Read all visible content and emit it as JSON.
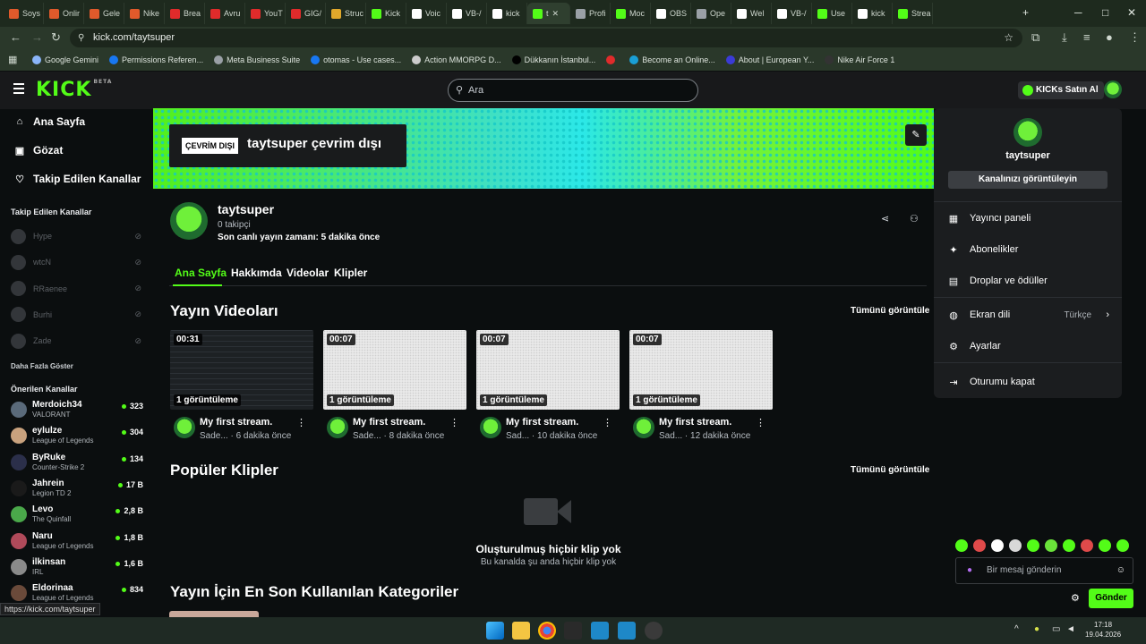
{
  "browser": {
    "tabs": [
      {
        "label": "Soys",
        "color": "#e05a2b"
      },
      {
        "label": "Onlir",
        "color": "#e05a2b"
      },
      {
        "label": "Gele",
        "color": "#e05a2b"
      },
      {
        "label": "Nike",
        "color": "#e05a2b"
      },
      {
        "label": "Brea",
        "color": "#e02b2b"
      },
      {
        "label": "Avru",
        "color": "#e02b2b"
      },
      {
        "label": "YouT",
        "color": "#e02b2b"
      },
      {
        "label": "GIG/",
        "color": "#e02b2b"
      },
      {
        "label": "Struc",
        "color": "#e0a82b"
      },
      {
        "label": "Kick",
        "color": "#53fc18"
      },
      {
        "label": "Voic",
        "color": "#ffffff"
      },
      {
        "label": "VB-/",
        "color": "#ffffff"
      },
      {
        "label": "kick",
        "color": "#ffffff"
      },
      {
        "label": "t",
        "color": "#53fc18"
      },
      {
        "label": "Profi",
        "color": "#9aa0a6"
      },
      {
        "label": "Moc",
        "color": "#53fc18"
      },
      {
        "label": "OBS",
        "color": "#ffffff"
      },
      {
        "label": "Ope",
        "color": "#9aa0a6"
      },
      {
        "label": "Wel",
        "color": "#ffffff"
      },
      {
        "label": "VB-/",
        "color": "#ffffff"
      },
      {
        "label": "Use",
        "color": "#53fc18"
      },
      {
        "label": "kick",
        "color": "#ffffff"
      },
      {
        "label": "Strea",
        "color": "#53fc18"
      }
    ],
    "url": "kick.com/taytsuper",
    "bookmarks": [
      {
        "label": "Google Gemini",
        "color": "#8ab4f8"
      },
      {
        "label": "Permissions Referen...",
        "color": "#1877f2"
      },
      {
        "label": "Meta Business Suite",
        "color": "#9aa0a6"
      },
      {
        "label": "otomas - Use cases...",
        "color": "#1877f2"
      },
      {
        "label": "Action MMORPG D...",
        "color": "#cccccc"
      },
      {
        "label": "Dükkanın İstanbul...",
        "color": "#000000"
      },
      {
        "label": "",
        "color": "#e02b2b"
      },
      {
        "label": "Become an Online...",
        "color": "#1a9fd6"
      },
      {
        "label": "About | European Y...",
        "color": "#3b3bd6"
      },
      {
        "label": "Nike Air Force 1",
        "color": "#333333"
      }
    ],
    "status_url": "https://kick.com/taytsuper"
  },
  "kick": {
    "logo": "KICK",
    "logo_badge": "BETA",
    "search_placeholder": "Ara",
    "buy_kicks": "KICKs Satın Al",
    "sidebar": {
      "nav": [
        {
          "label": "Ana Sayfa",
          "icon": "home-icon",
          "glyph": "⌂"
        },
        {
          "label": "Gözat",
          "icon": "browse-icon",
          "glyph": "▣"
        },
        {
          "label": "Takip Edilen Kanallar",
          "icon": "heart-icon",
          "glyph": "♡"
        }
      ],
      "followed_title": "Takip Edilen Kanallar",
      "followed": [
        "Hype",
        "wtcN",
        "RRaenee",
        "Burhi",
        "Zade"
      ],
      "show_more": "Daha Fazla Göster",
      "recommended_title": "Önerilen Kanallar",
      "recommended": [
        {
          "name": "Merdoich34",
          "category": "VALORANT",
          "viewers": "323",
          "color": "#5a6a7a"
        },
        {
          "name": "eylulze",
          "category": "League of Legends",
          "viewers": "304",
          "color": "#c9a27e"
        },
        {
          "name": "ByRuke",
          "category": "Counter-Strike 2",
          "viewers": "134",
          "color": "#2b2f4a"
        },
        {
          "name": "Jahrein",
          "category": "Legion TD 2",
          "viewers": "17 B",
          "color": "#1a1a1a"
        },
        {
          "name": "Levo",
          "category": "The Quinfall",
          "viewers": "2,8 B",
          "color": "#4aa84a"
        },
        {
          "name": "Naru",
          "category": "League of Legends",
          "viewers": "1,8 B",
          "color": "#b04a5a"
        },
        {
          "name": "ilkinsan",
          "category": "IRL",
          "viewers": "1,6 B",
          "color": "#8a8a8a"
        },
        {
          "name": "Eldorinaa",
          "category": "League of Legends",
          "viewers": "834",
          "color": "#6a4a3a"
        }
      ]
    },
    "banner": {
      "offline_tag": "ÇEVRİM DIŞI",
      "offline_text": "taytsuper çevrim dışı"
    },
    "channel": {
      "name": "taytsuper",
      "followers": "0 takipçi",
      "last_live": "Son canlı yayın zamanı: 5 dakika önce"
    },
    "tabs": [
      "Ana Sayfa",
      "Hakkımda",
      "Videolar",
      "Klipler"
    ],
    "videos_title": "Yayın Videoları",
    "see_all": "Tümünü görüntüle",
    "videos": [
      {
        "duration": "00:31",
        "views": "1 görüntüleme",
        "title": "My first stream.",
        "sub": "Sade... · 6 dakika önce"
      },
      {
        "duration": "00:07",
        "views": "1 görüntüleme",
        "title": "My first stream.",
        "sub": "Sade... · 8 dakika önce"
      },
      {
        "duration": "00:07",
        "views": "1 görüntüleme",
        "title": "My first stream.",
        "sub": "Sad... · 10 dakika önce"
      },
      {
        "duration": "00:07",
        "views": "1 görüntüleme",
        "title": "My first stream.",
        "sub": "Sad... · 12 dakika önce"
      }
    ],
    "clips_title": "Popüler Klipler",
    "no_clips_title": "Oluşturulmuş hiçbir klip yok",
    "no_clips_sub": "Bu kanalda şu anda hiçbir klip yok",
    "categories_title": "Yayın İçin En Son Kullanılan Kategoriler",
    "dropdown": {
      "username": "taytsuper",
      "view_channel": "Kanalınızı görüntüleyin",
      "items": [
        {
          "label": "Yayıncı paneli",
          "icon": "dashboard-icon",
          "glyph": "▦"
        },
        {
          "label": "Abonelikler",
          "icon": "sparkle-icon",
          "glyph": "✦"
        },
        {
          "label": "Droplar ve ödüller",
          "icon": "gift-icon",
          "glyph": "▤"
        },
        {
          "label": "Ekran dili",
          "icon": "globe-icon",
          "glyph": "◍",
          "value": "Türkçe"
        },
        {
          "label": "Ayarlar",
          "icon": "gear-icon",
          "glyph": "⚙"
        },
        {
          "label": "Oturumu kapat",
          "icon": "logout-icon",
          "glyph": "⇥"
        }
      ]
    },
    "chat": {
      "placeholder": "Bir mesaj gönderin",
      "send": "Gönder"
    }
  },
  "taskbar": {
    "time": "17:18",
    "date": "19.04.2026"
  }
}
